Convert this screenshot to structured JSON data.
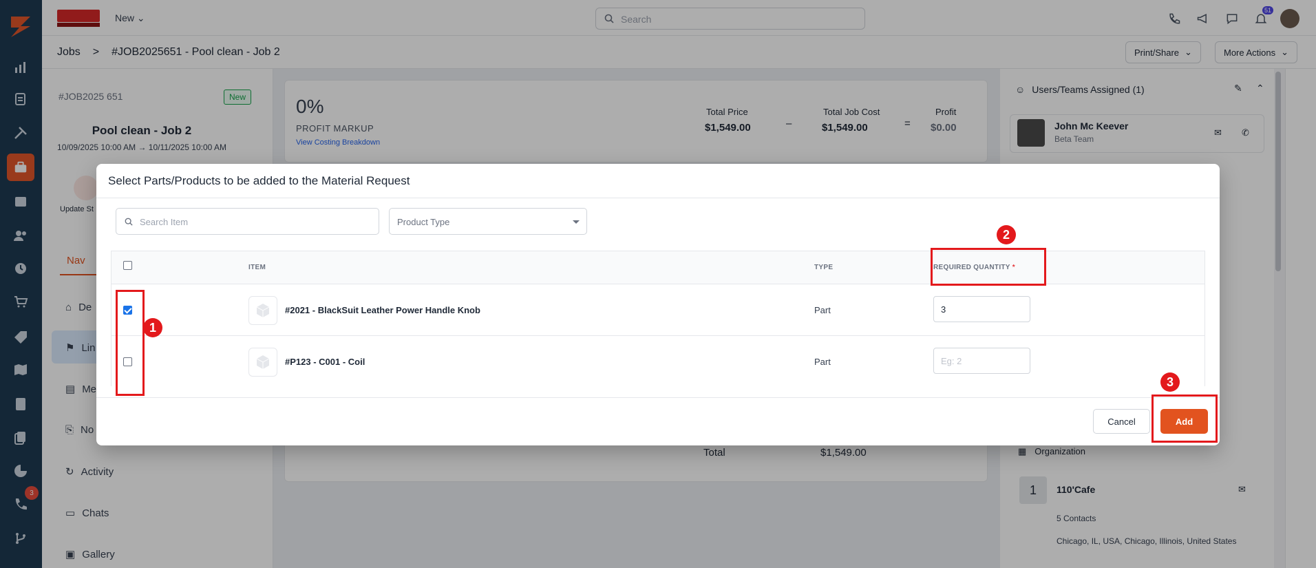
{
  "topbar": {
    "new_label": "New",
    "search_placeholder": "Search",
    "notification_count": "51"
  },
  "breadcrumb": {
    "root": "Jobs",
    "separator": ">",
    "current": "#JOB2025651 - Pool clean - Job 2"
  },
  "header_actions": {
    "print_share": "Print/Share",
    "more_actions": "More Actions"
  },
  "rail": {
    "call_badge": "3"
  },
  "job": {
    "id": "#JOB2025 651",
    "status": "New",
    "title": "Pool clean - Job 2",
    "dates": "10/09/2025 10:00 AM → 10/11/2025 10:00 AM",
    "update_status_label": "Update St"
  },
  "left_nav": {
    "tab_label": "Nav",
    "items": [
      {
        "label": "De"
      },
      {
        "label": "Lin"
      },
      {
        "label": "Me"
      },
      {
        "label": "No"
      },
      {
        "label": "Activity"
      },
      {
        "label": "Chats"
      },
      {
        "label": "Gallery"
      }
    ]
  },
  "profit": {
    "percent": "0%",
    "label": "PROFIT MARKUP",
    "link": "View Costing Breakdown",
    "total_price_label": "Total Price",
    "total_price": "$1,549.00",
    "minus": "–",
    "total_cost_label": "Total Job Cost",
    "total_cost": "$1,549.00",
    "equals": "=",
    "profit_label": "Profit",
    "profit_value": "$0.00",
    "total_label": "Total",
    "total_value": "$1,549.00"
  },
  "right_panel": {
    "assigned_title": "Users/Teams Assigned (1)",
    "user_name": "John Mc Keever",
    "user_team": "Beta Team",
    "org_title": "Organization",
    "org_initial": "1",
    "org_name": "110'Cafe",
    "contacts": "5 Contacts",
    "address": "Chicago, IL, USA, Chicago, Illinois, United States"
  },
  "modal": {
    "title": "Select Parts/Products to be added to the Material Request",
    "search_placeholder": "Search Item",
    "product_type_placeholder": "Product Type",
    "columns": {
      "item": "ITEM",
      "type": "TYPE",
      "required_quantity": "REQUIRED QUANTITY",
      "required_star": "*"
    },
    "rows": [
      {
        "name": "#2021 - BlackSuit Leather Power Handle Knob",
        "type": "Part",
        "quantity": "3",
        "checked": true
      },
      {
        "name": "#P123 - C001 - Coil",
        "type": "Part",
        "quantity": "",
        "placeholder": "Eg: 2",
        "checked": false
      }
    ],
    "cancel_label": "Cancel",
    "add_label": "Add"
  },
  "annotations": [
    "1",
    "2",
    "3"
  ],
  "colors": {
    "brand_orange": "#e2531f",
    "rail_navy": "#1e3a52",
    "annotation_red": "#e3191c",
    "status_green": "#16a34a"
  }
}
